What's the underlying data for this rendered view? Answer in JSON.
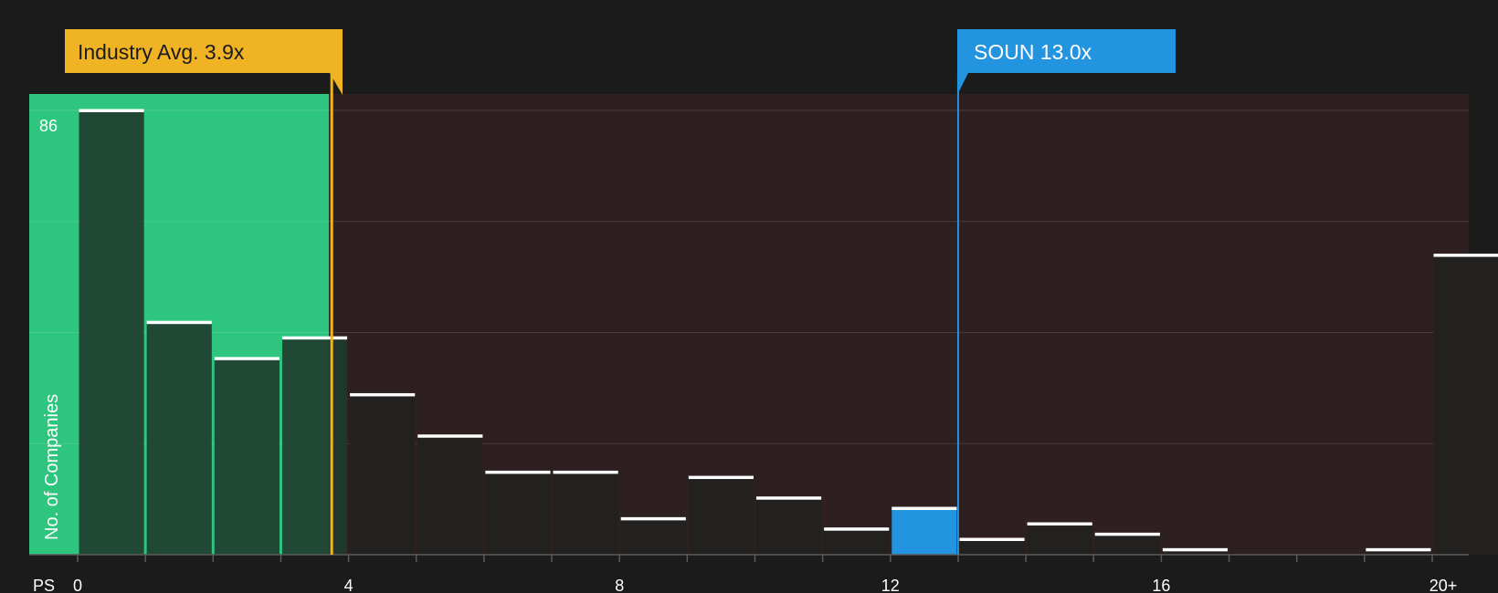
{
  "chart_data": {
    "type": "bar",
    "x_axis_label": "PS",
    "y_axis_label": "No. of Companies",
    "y_max_label": "86",
    "ylim": [
      0,
      86
    ],
    "x_ticks": [
      "0",
      "4",
      "8",
      "12",
      "16",
      "20+"
    ],
    "bins": [
      {
        "from": 0,
        "to": 1,
        "value": 86
      },
      {
        "from": 1,
        "to": 2,
        "value": 45
      },
      {
        "from": 2,
        "to": 3,
        "value": 38
      },
      {
        "from": 3,
        "to": 4,
        "value": 42
      },
      {
        "from": 4,
        "to": 5,
        "value": 31
      },
      {
        "from": 5,
        "to": 6,
        "value": 23
      },
      {
        "from": 6,
        "to": 7,
        "value": 16
      },
      {
        "from": 7,
        "to": 8,
        "value": 16
      },
      {
        "from": 8,
        "to": 9,
        "value": 7
      },
      {
        "from": 9,
        "to": 10,
        "value": 15
      },
      {
        "from": 10,
        "to": 11,
        "value": 11
      },
      {
        "from": 11,
        "to": 12,
        "value": 5
      },
      {
        "from": 12,
        "to": 13,
        "value": 9,
        "highlight": true
      },
      {
        "from": 13,
        "to": 14,
        "value": 3
      },
      {
        "from": 14,
        "to": 15,
        "value": 6
      },
      {
        "from": 15,
        "to": 16,
        "value": 4
      },
      {
        "from": 16,
        "to": 17,
        "value": 1
      },
      {
        "from": 17,
        "to": 18,
        "value": 0
      },
      {
        "from": 18,
        "to": 19,
        "value": 0
      },
      {
        "from": 19,
        "to": 20,
        "value": 1
      },
      {
        "from": 20,
        "to": 21,
        "value": 58
      }
    ],
    "industry_avg": {
      "label": "Industry Avg. 3.9x",
      "value": 3.9
    },
    "company": {
      "label": "SOUN 13.0x",
      "value": 13.0
    },
    "colors": {
      "background": "#1b1b1b",
      "fair_zone": "#2ec57e",
      "over_zone": "#2e1f20",
      "industry": "#f0b323",
      "company": "#2394e0",
      "bar_dark": "#222120",
      "bar_top": "#ffffff"
    }
  }
}
